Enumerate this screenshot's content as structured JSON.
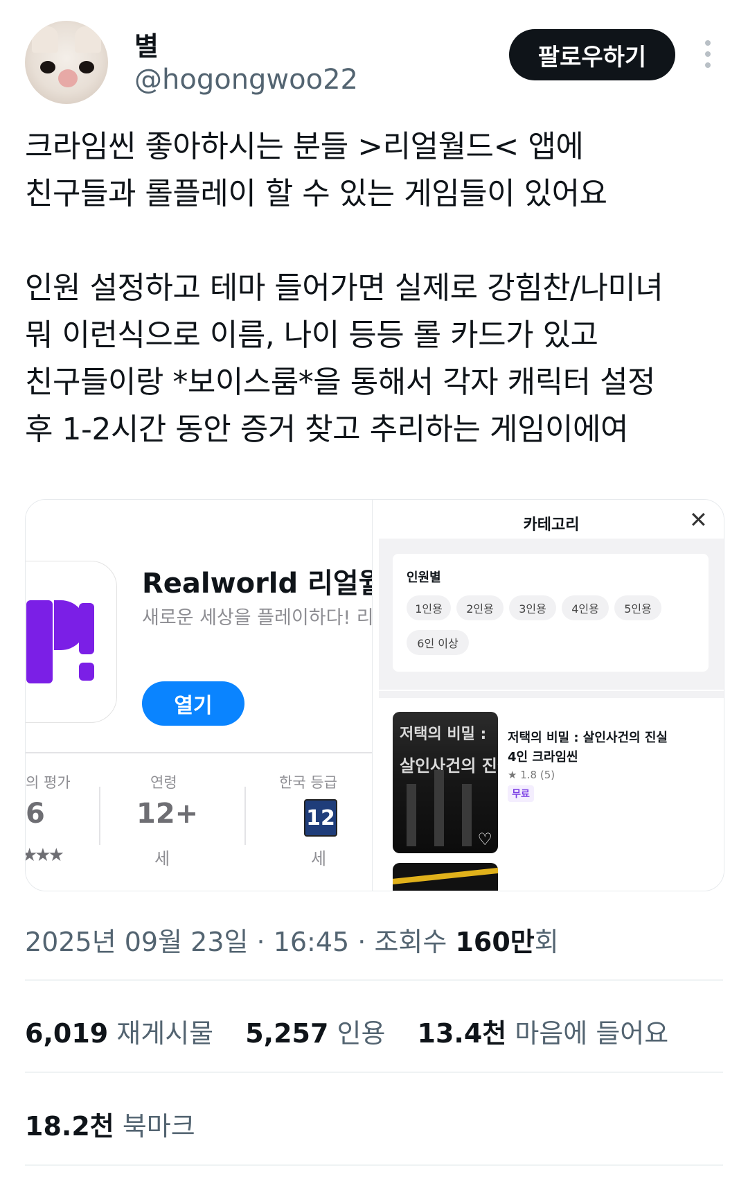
{
  "user": {
    "name": "별",
    "handle": "@hogongwoo22",
    "follow_label": "팔로우하기"
  },
  "tweet": {
    "lines_a": [
      "크라임씬 좋아하시는 분들 >리얼월드< 앱에",
      "친구들과 롤플레이 할 수 있는 게임들이 있어요"
    ],
    "lines_b": [
      "인원 설정하고 테마 들어가면 실제로 강힘찬/나미녀",
      "뭐 이런식으로 이름, 나이 등등 롤 카드가 있고",
      "친구들이랑 *보이스룸*을 통해서 각자 캐릭터 설정",
      "후 1-2시간 동안 증거 찾고 추리하는 게임이에여"
    ]
  },
  "app_card": {
    "title": "Realworld 리얼월!",
    "subtitle": "새로운 세상을 플레이하다! 리",
    "open_label": "열기",
    "stats": {
      "rating_label": "의 평가",
      "rating_value": "6",
      "rating_stars": "★★★",
      "age_label": "연령",
      "age_value": "12+",
      "age_unit": "세",
      "korea_label": "한국 등급",
      "korea_badge": "12",
      "korea_unit": "세"
    },
    "brand_color": "#7b1fe6"
  },
  "category": {
    "title": "카테고리",
    "section_label": "인원별",
    "chips": [
      "1인용",
      "2인용",
      "3인용",
      "4인용",
      "5인용",
      "6인 이상"
    ]
  },
  "game": {
    "thumb_line1": "저택의 비밀 :",
    "thumb_line2": "살인사건의 진실",
    "title_line1": "저택의 비밀 : 살인사건의 진실",
    "title_line2": "4인 크라임씬",
    "rating": "1.8 (5)",
    "price": "무료"
  },
  "meta": {
    "date": "2025년 09월 23일",
    "time": "16:45",
    "views_label": "조회수",
    "views_value": "160만",
    "views_suffix": "회"
  },
  "engagement": {
    "reposts": "6,019",
    "reposts_label": "재게시물",
    "quotes": "5,257",
    "quotes_label": "인용",
    "likes": "13.4천",
    "likes_label": "마음에 들어요",
    "bookmarks": "18.2천",
    "bookmarks_label": "북마크"
  }
}
